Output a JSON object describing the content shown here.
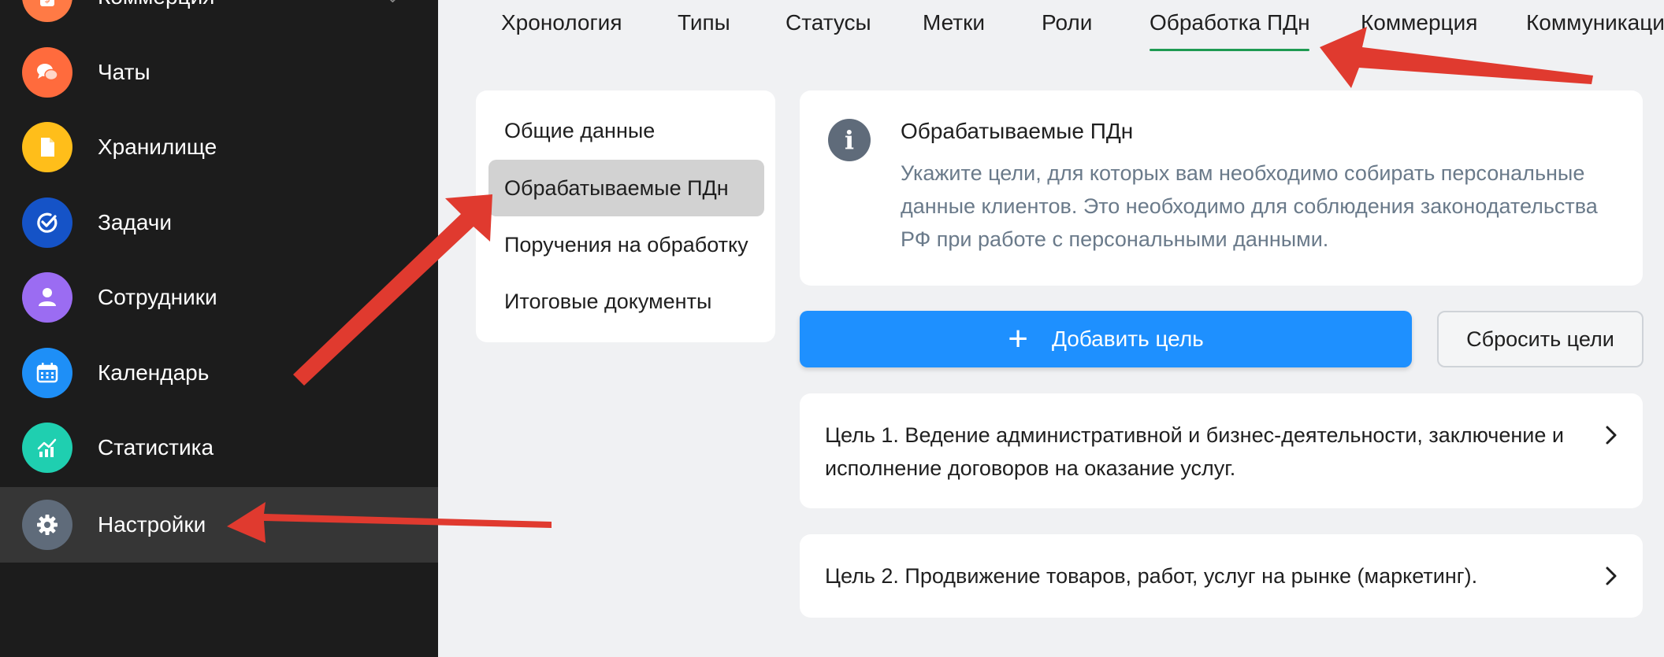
{
  "colors": {
    "sidebar_bg": "#1c1c1c",
    "sidebar_active_bg": "#363636",
    "content_bg": "#f0f1f3",
    "tab_underline": "#1e9a52",
    "primary_button": "#1e90ff",
    "info_icon_bg": "#5f6b7a",
    "annotation_arrow": "#e03a2f"
  },
  "sidebar": {
    "items": [
      {
        "label": "Коммерция",
        "icon": "wallet-icon",
        "color": "#ff7a45"
      },
      {
        "label": "Чаты",
        "icon": "chat-bubbles-icon",
        "color": "#ff6b3d"
      },
      {
        "label": "Хранилище",
        "icon": "file-icon",
        "color": "#ffbe1a"
      },
      {
        "label": "Задачи",
        "icon": "task-check-icon",
        "color": "#1553c7"
      },
      {
        "label": "Сотрудники",
        "icon": "person-icon",
        "color": "#9b6cf2"
      },
      {
        "label": "Календарь",
        "icon": "calendar-icon",
        "color": "#1e8ff7"
      },
      {
        "label": "Статистика",
        "icon": "chart-icon",
        "color": "#1fcfb0"
      },
      {
        "label": "Настройки",
        "icon": "gear-icon",
        "color": "#5f6b7a",
        "active": true
      }
    ]
  },
  "tabs": {
    "items": [
      "Хронология",
      "Типы",
      "Статусы",
      "Метки",
      "Роли",
      "Обработка ПДн",
      "Коммерция",
      "Коммуникаци"
    ],
    "active": "Обработка ПДн"
  },
  "submenu": {
    "items": [
      "Общие данные",
      "Обрабатываемые ПДн",
      "Поручения на обработку",
      "Итоговые документы"
    ],
    "active": "Обрабатываемые ПДн"
  },
  "info": {
    "icon": "info-icon",
    "title": "Обрабатываемые ПДн",
    "text": "Укажите цели, для которых вам необходимо собирать персональные данные клиентов. Это необходимо для соблюдения законодательства РФ при работе с персональными данными."
  },
  "buttons": {
    "add": "Добавить цель",
    "reset": "Сбросить цели"
  },
  "goals": [
    {
      "text": "Цель 1. Ведение административной и бизнес-деятельности, заключение и исполнение договоров на оказание услуг."
    },
    {
      "text": "Цель 2. Продвижение товаров, работ, услуг на рынке (маркетинг)."
    }
  ]
}
